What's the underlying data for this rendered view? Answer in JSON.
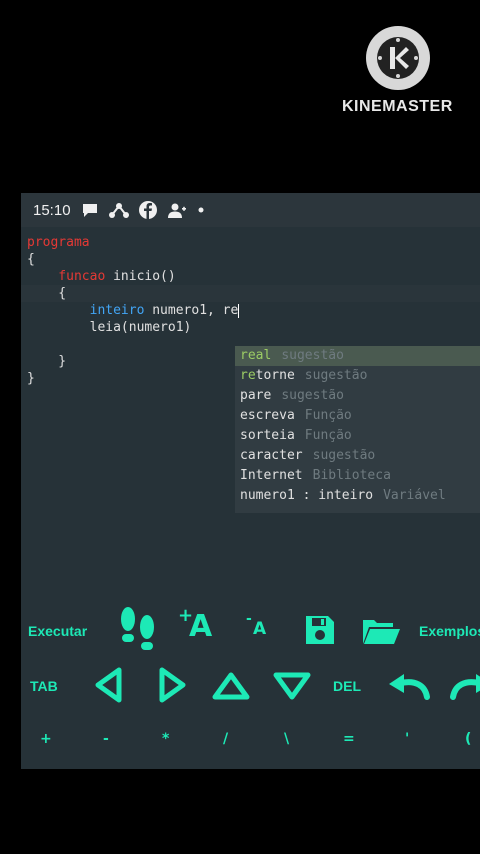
{
  "watermark": {
    "text": "KINEMASTER"
  },
  "statusbar": {
    "time": "15:10",
    "icons": [
      "chat-bubble-icon",
      "network-icon",
      "facebook-icon",
      "add-person-icon",
      "dot-icon"
    ]
  },
  "editor": {
    "lines": [
      {
        "parts": [
          {
            "t": "programa",
            "c": "red"
          }
        ]
      },
      {
        "parts": [
          {
            "t": "{",
            "c": "txt"
          }
        ]
      },
      {
        "parts": [
          {
            "t": "    funcao ",
            "c": "red"
          },
          {
            "t": "inicio()",
            "c": "txt"
          }
        ]
      },
      {
        "parts": [
          {
            "t": "    {",
            "c": "txt"
          }
        ]
      },
      {
        "parts": [
          {
            "t": "        inteiro ",
            "c": "blue"
          },
          {
            "t": "numero1, re",
            "c": "txt"
          }
        ]
      },
      {
        "parts": [
          {
            "t": "        leia(numero1)",
            "c": "txt"
          }
        ]
      },
      {
        "parts": [
          {
            "t": "",
            "c": "txt"
          }
        ]
      },
      {
        "parts": [
          {
            "t": "    }",
            "c": "txt"
          }
        ]
      },
      {
        "parts": [
          {
            "t": "}",
            "c": "txt"
          }
        ]
      }
    ]
  },
  "autocomplete": {
    "items": [
      {
        "match": "re",
        "rest": "al",
        "type": "sugestão"
      },
      {
        "match": "re",
        "rest": "torne",
        "type": "sugestão"
      },
      {
        "match": "",
        "rest": "pare",
        "type": "sugestão"
      },
      {
        "match": "",
        "rest": "escreva",
        "type": "Função"
      },
      {
        "match": "",
        "rest": "sorteia",
        "type": "Função"
      },
      {
        "match": "",
        "rest": "caracter",
        "type": "sugestão"
      },
      {
        "match": "",
        "rest": "Internet",
        "type": "Biblioteca"
      },
      {
        "match": "",
        "rest": "numero1 : inteiro",
        "type": "Variável"
      }
    ]
  },
  "toolbar": {
    "run_label": "Executar",
    "examples_label": "Exemplos",
    "tab_label": "TAB",
    "del_label": "DEL",
    "increase_font_icon_text": "A",
    "decrease_font_icon_text": "A",
    "accent": "#1de9b6"
  },
  "symbols": [
    "+",
    "-",
    "*",
    "/",
    "\\",
    "=",
    "'",
    "("
  ]
}
